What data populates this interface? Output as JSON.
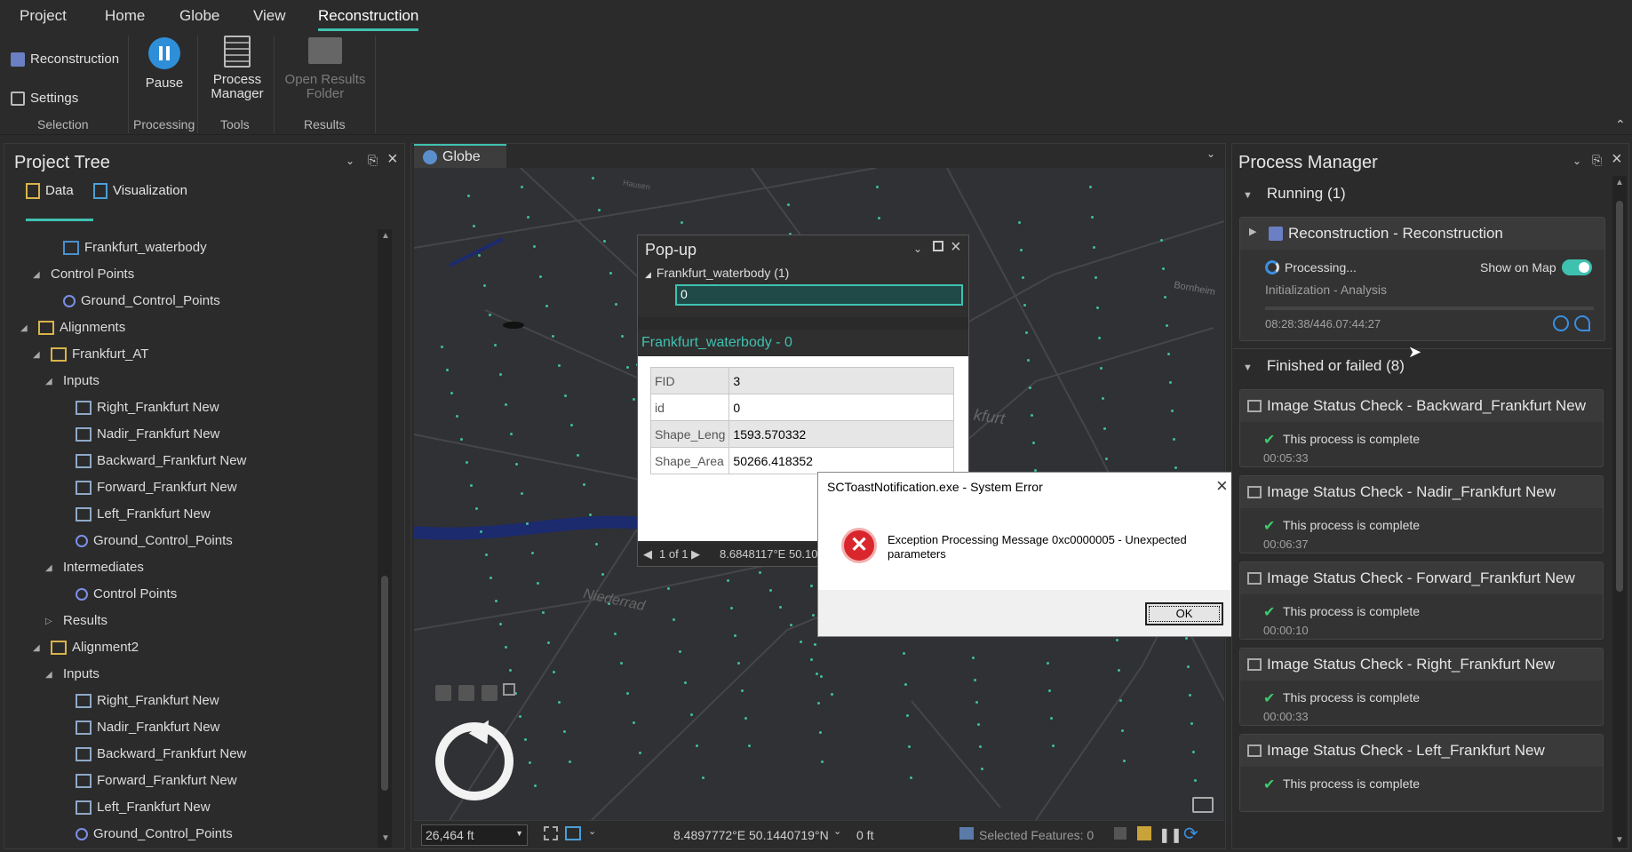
{
  "menu": {
    "items": [
      "Project",
      "Home",
      "Globe",
      "View",
      "Reconstruction"
    ],
    "active": "Reconstruction"
  },
  "ribbon": {
    "reconstruction": "Reconstruction",
    "settings": "Settings",
    "pause": "Pause",
    "process_manager_l1": "Process",
    "process_manager_l2": "Manager",
    "open_results_l1": "Open Results",
    "open_results_l2": "Folder",
    "groups": {
      "selection": "Selection",
      "processing": "Processing",
      "tools": "Tools",
      "results": "Results"
    }
  },
  "project_tree": {
    "title": "Project Tree",
    "tab_data": "Data",
    "tab_visualization": "Visualization",
    "rows": [
      {
        "label": "Frankfurt_waterbody",
        "indent": 2,
        "icon": "raster"
      },
      {
        "label": "Control Points",
        "indent": 1,
        "icon": "none",
        "toggle": "down"
      },
      {
        "label": "Ground_Control_Points",
        "indent": 2,
        "icon": "gcp"
      },
      {
        "label": "Alignments",
        "indent": 0,
        "icon": "folder",
        "toggle": "down"
      },
      {
        "label": "Frankfurt_AT",
        "indent": 1,
        "icon": "align",
        "toggle": "down"
      },
      {
        "label": "Inputs",
        "indent": 2,
        "icon": "none",
        "toggle": "down"
      },
      {
        "label": "Right_Frankfurt New",
        "indent": 3,
        "icon": "images"
      },
      {
        "label": "Nadir_Frankfurt New",
        "indent": 3,
        "icon": "images"
      },
      {
        "label": "Backward_Frankfurt New",
        "indent": 3,
        "icon": "images"
      },
      {
        "label": "Forward_Frankfurt New",
        "indent": 3,
        "icon": "images"
      },
      {
        "label": "Left_Frankfurt New",
        "indent": 3,
        "icon": "images"
      },
      {
        "label": "Ground_Control_Points",
        "indent": 3,
        "icon": "gcp"
      },
      {
        "label": "Intermediates",
        "indent": 2,
        "icon": "none",
        "toggle": "down"
      },
      {
        "label": "Control Points",
        "indent": 3,
        "icon": "gcp"
      },
      {
        "label": "Results",
        "indent": 2,
        "icon": "none",
        "toggle": "right"
      },
      {
        "label": "Alignment2",
        "indent": 1,
        "icon": "align",
        "toggle": "down"
      },
      {
        "label": "Inputs",
        "indent": 2,
        "icon": "none",
        "toggle": "down"
      },
      {
        "label": "Right_Frankfurt New",
        "indent": 3,
        "icon": "images"
      },
      {
        "label": "Nadir_Frankfurt New",
        "indent": 3,
        "icon": "images"
      },
      {
        "label": "Backward_Frankfurt New",
        "indent": 3,
        "icon": "images"
      },
      {
        "label": "Forward_Frankfurt New",
        "indent": 3,
        "icon": "images"
      },
      {
        "label": "Left_Frankfurt New",
        "indent": 3,
        "icon": "images"
      },
      {
        "label": "Ground_Control_Points",
        "indent": 3,
        "icon": "gcp"
      }
    ]
  },
  "globe": {
    "tab": "Globe",
    "map_labels": {
      "niederrad": "Niederrad",
      "kfurt": "kfurt",
      "bornheim": "Bornheim",
      "hausen": "Hausen"
    },
    "scale": "26,464 ft",
    "coords": "8.4897772°E 50.1440719°N",
    "elevation": "0 ft",
    "selected_features": "Selected Features: 0"
  },
  "popup": {
    "title": "Pop-up",
    "layer": "Frankfurt_waterbody (1)",
    "value": "0",
    "feature_title": "Frankfurt_waterbody - 0",
    "attributes": [
      {
        "field": "FID",
        "value": "3"
      },
      {
        "field": "id",
        "value": "0"
      },
      {
        "field": "Shape_Leng",
        "value": "1593.570332"
      },
      {
        "field": "Shape_Area",
        "value": "50266.418352"
      }
    ],
    "pager": "1 of 1",
    "coords": "8.6848117°E 50.10"
  },
  "dialog": {
    "title": "SCToastNotification.exe - System Error",
    "message": "Exception Processing Message 0xc0000005 - Unexpected parameters",
    "ok": "OK"
  },
  "process_manager": {
    "title": "Process Manager",
    "running_header": "Running (1)",
    "running": {
      "title": "Reconstruction - Reconstruction",
      "status": "Processing...",
      "show_on_map": "Show on Map",
      "stage": "Initialization - Analysis",
      "time": "08:28:38/446.07:44:27",
      "progress": 0.0
    },
    "finished_header": "Finished or failed (8)",
    "finished": [
      {
        "title": "Image Status Check - Backward_Frankfurt New",
        "status": "This process is complete",
        "time": "00:05:33"
      },
      {
        "title": "Image Status Check - Nadir_Frankfurt New",
        "status": "This process is complete",
        "time": "00:06:37"
      },
      {
        "title": "Image Status Check - Forward_Frankfurt New",
        "status": "This process is complete",
        "time": "00:00:10"
      },
      {
        "title": "Image Status Check - Right_Frankfurt New",
        "status": "This process is complete",
        "time": "00:00:33"
      },
      {
        "title": "Image Status Check - Left_Frankfurt New",
        "status": "This process is complete",
        "time": ""
      }
    ]
  },
  "colors": {
    "accent": "#3fc1b0",
    "error": "#d9262c",
    "check": "#3fc96e",
    "link": "#3fc1b0"
  }
}
